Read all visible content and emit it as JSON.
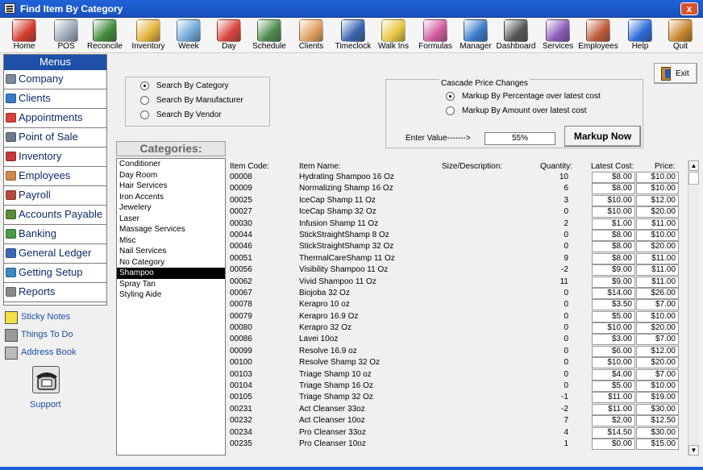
{
  "window": {
    "title": "Find Item By Category",
    "close_glyph": "x"
  },
  "toolbar": [
    {
      "label": "Home",
      "icon": "house-icon",
      "color": "#d33a2c"
    },
    {
      "label": "POS",
      "icon": "cash-register-icon",
      "color": "#9aa8b8"
    },
    {
      "label": "Reconcile",
      "icon": "money-icon",
      "color": "#3f8a3a"
    },
    {
      "label": "Inventory",
      "icon": "forklift-icon",
      "color": "#e2b23a"
    },
    {
      "label": "Week",
      "icon": "calendar-week-icon",
      "color": "#6fa7d6"
    },
    {
      "label": "Day",
      "icon": "calendar-day-icon",
      "color": "#d9423a"
    },
    {
      "label": "Schedule",
      "icon": "schedule-grid-icon",
      "color": "#4e8a4e"
    },
    {
      "label": "Clients",
      "icon": "handshake-icon",
      "color": "#e0a060"
    },
    {
      "label": "Timeclock",
      "icon": "clock-icon",
      "color": "#3a62b0"
    },
    {
      "label": "Walk Ins",
      "icon": "walk-in-clock-icon",
      "color": "#e7c640"
    },
    {
      "label": "Formulas",
      "icon": "test-tubes-icon",
      "color": "#d05aa0"
    },
    {
      "label": "Manager",
      "icon": "globe-icon",
      "color": "#3a7ac8"
    },
    {
      "label": "Dashboard",
      "icon": "gauge-icon",
      "color": "#555555"
    },
    {
      "label": "Services",
      "icon": "tools-icon",
      "color": "#8a5ab8"
    },
    {
      "label": "Employees",
      "icon": "people-icon",
      "color": "#c05a3a"
    },
    {
      "label": "Help",
      "icon": "help-icon",
      "color": "#2a6ad8"
    },
    {
      "label": "Quit",
      "icon": "door-icon",
      "color": "#c8852b"
    }
  ],
  "menus": {
    "title": "Menus",
    "items": [
      {
        "label": "Company",
        "icon": "building-icon",
        "color": "#7a8a9a"
      },
      {
        "label": "Clients",
        "icon": "clients-icon",
        "color": "#3a7ac8"
      },
      {
        "label": "Appointments",
        "icon": "calendar-icon",
        "color": "#d9423a"
      },
      {
        "label": "Point of Sale",
        "icon": "register-icon",
        "color": "#6a7a8a"
      },
      {
        "label": "Inventory",
        "icon": "boxes-icon",
        "color": "#c83a3a"
      },
      {
        "label": "Employees",
        "icon": "employee-icon",
        "color": "#d08a4a"
      },
      {
        "label": "Payroll",
        "icon": "payroll-icon",
        "color": "#b84a3a"
      },
      {
        "label": "Accounts Payable",
        "icon": "payable-icon",
        "color": "#5a8a3a"
      },
      {
        "label": "Banking",
        "icon": "cash-icon",
        "color": "#4a9a4a"
      },
      {
        "label": "General Ledger",
        "icon": "ledger-icon",
        "color": "#3a6ab8"
      },
      {
        "label": "Getting Setup",
        "icon": "setup-icon",
        "color": "#3a8ac8"
      },
      {
        "label": "Reports",
        "icon": "report-icon",
        "color": "#8a8a8a"
      }
    ]
  },
  "extras": [
    {
      "label": "Sticky Notes",
      "icon": "sticky-note-icon",
      "color": "#f2e040"
    },
    {
      "label": "Things To Do",
      "icon": "hammer-icon",
      "color": "#999999"
    },
    {
      "label": "Address Book",
      "icon": "address-book-icon",
      "color": "#bbbbbb"
    }
  ],
  "support": {
    "label": "Support",
    "icon": "telephone-icon"
  },
  "search": {
    "options": [
      {
        "label": "Search By Category",
        "selected": true
      },
      {
        "label": "Search By Manufacturer",
        "selected": false
      },
      {
        "label": "Search By Vendor",
        "selected": false
      }
    ]
  },
  "cascade": {
    "title": "Cascade Price Changes",
    "options": [
      {
        "label": "Markup By Percentage over latest cost",
        "selected": true
      },
      {
        "label": "Markup By Amount over latest cost",
        "selected": false
      }
    ],
    "enter_label": "Enter Value------->",
    "value": "55%",
    "button": "Markup Now"
  },
  "exit": {
    "label": "Exit"
  },
  "categories": {
    "title": "Categories:",
    "selected": "Shampoo",
    "items": [
      "Conditioner",
      "Day Room",
      "Hair Services",
      "Iron Accents",
      "Jewelery",
      "Laser",
      "Massage Services",
      "Misc",
      "Nail Services",
      "No Category",
      "Shampoo",
      "Spray Tan",
      "Styling Aide"
    ]
  },
  "grid": {
    "columns": {
      "code": "Item Code:",
      "name": "Item Name:",
      "size": "Size/Description:",
      "qty": "Quantity:",
      "cost": "Latest Cost:",
      "price": "Price:"
    },
    "rows": [
      [
        "00008",
        "Hydrating Shampoo 16 Oz",
        "10",
        "$8.00",
        "$10.00"
      ],
      [
        "00009",
        "Normalizing Shamp 16 Oz",
        "6",
        "$8.00",
        "$10.00"
      ],
      [
        "00025",
        "IceCap Shamp 11 Oz",
        "3",
        "$10.00",
        "$12.00"
      ],
      [
        "00027",
        "IceCap Shamp 32 Oz",
        "0",
        "$10.00",
        "$20.00"
      ],
      [
        "00030",
        "Infusion Shamp 11 Oz",
        "2",
        "$1.00",
        "$11.00"
      ],
      [
        "00044",
        "StickStraightShamp 8 Oz",
        "0",
        "$8.00",
        "$10.00"
      ],
      [
        "00046",
        "StickStraightShamp 32 Oz",
        "0",
        "$8.00",
        "$20.00"
      ],
      [
        "00051",
        "ThermalCareShamp 11 Oz",
        "9",
        "$8.00",
        "$11.00"
      ],
      [
        "00056",
        "Visibility Shampoo 11 Oz",
        "-2",
        "$9.00",
        "$11.00"
      ],
      [
        "00062",
        "Vivid Shampoo 11 Oz",
        "11",
        "$9.00",
        "$11.00"
      ],
      [
        "00067",
        "Biojoba 32 Oz",
        "0",
        "$14.00",
        "$26.00"
      ],
      [
        "00078",
        "Kerapro 10 oz",
        "0",
        "$3.50",
        "$7.00"
      ],
      [
        "00079",
        "Kerapro 16.9 Oz",
        "0",
        "$5.00",
        "$10.00"
      ],
      [
        "00080",
        "Kerapro 32 Oz",
        "0",
        "$10.00",
        "$20.00"
      ],
      [
        "00086",
        "Lavei 10oz",
        "0",
        "$3.00",
        "$7.00"
      ],
      [
        "00099",
        "Resolve 16.9 oz",
        "0",
        "$6.00",
        "$12.00"
      ],
      [
        "00100",
        "Resolve Shamp 32 Oz",
        "0",
        "$10.00",
        "$20.00"
      ],
      [
        "00103",
        "Triage Shamp 10 oz",
        "0",
        "$4.00",
        "$7.00"
      ],
      [
        "00104",
        "Triage Shamp 16 Oz",
        "0",
        "$5.00",
        "$10.00"
      ],
      [
        "00105",
        "Triage Shamp 32 Oz",
        "-1",
        "$11.00",
        "$19.00"
      ],
      [
        "00231",
        "Act Cleanser 33oz",
        "-2",
        "$11.00",
        "$30.00"
      ],
      [
        "00232",
        "Act Cleanser 10oz",
        "7",
        "$2.00",
        "$12.50"
      ],
      [
        "00234",
        "Pro Cleanser 33oz",
        "4",
        "$14.50",
        "$30.00"
      ],
      [
        "00235",
        "Pro Cleanser 10oz",
        "1",
        "$0.00",
        "$15.00"
      ]
    ]
  }
}
